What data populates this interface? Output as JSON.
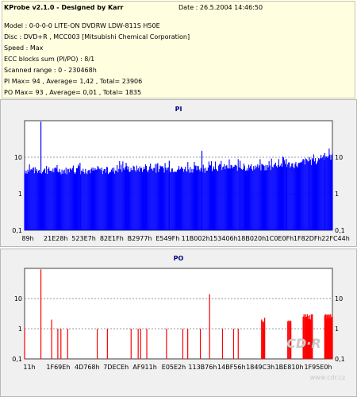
{
  "info": {
    "title": "KProbe v2.1.0 - Designed by Karr",
    "date": "Date : 26.5.2004 14:46:50",
    "lines": [
      "Model : 0-0-0-0 LITE-ON DVDRW LDW-811S  H50E",
      "Disc : DVD+R , MCC003 [Mitsubishi Chemical Corporation]",
      "Speed : Max",
      "ECC blocks sum (PI/PO) : 8/1",
      "Scanned range : 0 - 230468h",
      "PI Max= 94 , Average= 1,42 , Total= 23906",
      "PO Max= 93 , Average= 0,01 , Total= 1835"
    ]
  },
  "watermark": {
    "line1": "CD·R",
    "line2": "www.cdr.cz"
  },
  "colors": {
    "pi": "#0000ff",
    "po": "#ff0000",
    "grid": "#9a9a9a",
    "panel": "#f0f0f0",
    "info_bg": "#ffffe0",
    "title": "#000080"
  },
  "chart_data": [
    {
      "type": "bar",
      "title": "PI",
      "y_scale": "log",
      "ylim": [
        0.1,
        100
      ],
      "y_ticks": [
        "10",
        "1",
        "0,1"
      ],
      "x_ticks": [
        "89h",
        "21E28h",
        "523E7h",
        "82E1Fh",
        "B2977h",
        "E549Fh",
        "11B002h",
        "153406h",
        "18B020h",
        "1C0E0Fh",
        "1F82DFh",
        "22FC44h"
      ],
      "series": [
        {
          "baseline_segments": [
            [
              0.0,
              0.3,
              4.5
            ],
            [
              0.3,
              0.6,
              5.0
            ],
            [
              0.6,
              0.8,
              5.5
            ],
            [
              0.8,
              0.9,
              6.5
            ],
            [
              0.9,
              0.96,
              8.0
            ],
            [
              0.96,
              1.0,
              11.0
            ]
          ],
          "spikes": [
            {
              "pos": 0.053,
              "value": 94
            },
            {
              "pos": 0.576,
              "value": 15
            },
            {
              "pos": 0.18,
              "value": 7
            },
            {
              "pos": 0.33,
              "value": 7
            },
            {
              "pos": 0.47,
              "value": 8
            },
            {
              "pos": 0.7,
              "value": 8
            },
            {
              "pos": 0.85,
              "value": 9
            },
            {
              "pos": 0.925,
              "value": 10
            },
            {
              "pos": 0.975,
              "value": 13
            }
          ]
        }
      ]
    },
    {
      "type": "bar",
      "title": "PO",
      "y_scale": "log",
      "ylim": [
        0.1,
        100
      ],
      "y_ticks": [
        "10",
        "1",
        "0,1"
      ],
      "x_ticks": [
        "11h",
        "1F69Eh",
        "4D768h",
        "7DECEh",
        "AF911h",
        "E05E2h",
        "113B76h",
        "14BF56h",
        "1849C3h",
        "1BE810h",
        "1F95E0h"
      ],
      "series": [
        {
          "spikes": [
            {
              "pos": 0.0,
              "value": 1
            },
            {
              "pos": 0.053,
              "value": 93
            },
            {
              "pos": 0.088,
              "value": 2
            },
            {
              "pos": 0.108,
              "value": 1
            },
            {
              "pos": 0.118,
              "value": 1
            },
            {
              "pos": 0.14,
              "value": 1
            },
            {
              "pos": 0.236,
              "value": 1
            },
            {
              "pos": 0.269,
              "value": 1
            },
            {
              "pos": 0.346,
              "value": 1
            },
            {
              "pos": 0.369,
              "value": 1
            },
            {
              "pos": 0.377,
              "value": 1
            },
            {
              "pos": 0.397,
              "value": 1
            },
            {
              "pos": 0.461,
              "value": 1
            },
            {
              "pos": 0.514,
              "value": 1
            },
            {
              "pos": 0.53,
              "value": 1
            },
            {
              "pos": 0.571,
              "value": 1
            },
            {
              "pos": 0.601,
              "value": 14
            },
            {
              "pos": 0.643,
              "value": 1
            },
            {
              "pos": 0.679,
              "value": 1
            },
            {
              "pos": 0.694,
              "value": 1
            },
            {
              "pos": 0.775,
              "value": 1
            }
          ],
          "clusters": [
            {
              "from": 0.77,
              "to": 0.78,
              "value": 2,
              "count": 4
            },
            {
              "from": 0.855,
              "to": 0.865,
              "value": 2,
              "count": 4
            },
            {
              "from": 0.905,
              "to": 0.935,
              "value": 2.5,
              "count": 12,
              "peak": 3
            },
            {
              "from": 0.975,
              "to": 1.0,
              "value": 2.5,
              "count": 14,
              "peak": 3
            }
          ]
        }
      ]
    }
  ]
}
